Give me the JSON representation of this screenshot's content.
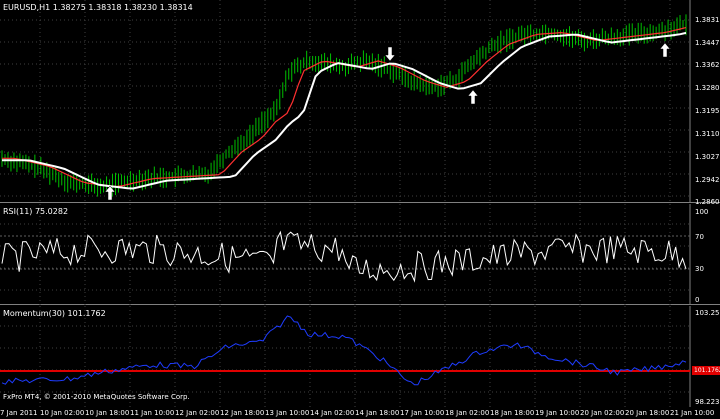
{
  "price_pane": {
    "header": "EURUSD,H1  1.38275 1.38318 1.38230 1.38314",
    "y_ticks": [
      "1.38318",
      "1.34475",
      "1.33625",
      "1.32800",
      "1.31950",
      "1.31100",
      "1.30275",
      "1.29425",
      "1.28600"
    ]
  },
  "rsi_pane": {
    "header": "RSI(11) 75.0282",
    "y_ticks": [
      "100",
      "70",
      "30",
      "0"
    ]
  },
  "momentum_pane": {
    "header": "Momentum(30) 101.1762",
    "y_ticks": [
      "103.252",
      "101.1762",
      "98.2235"
    ],
    "copyright": "FxPro MT4, © 2001-2010 MetaQuotes Software Corp."
  },
  "x_axis": {
    "ticks": [
      "7 Jan 2011",
      "10 Jan 02:00",
      "10 Jan 18:00",
      "11 Jan 10:00",
      "12 Jan 02:00",
      "12 Jan 18:00",
      "13 Jan 10:00",
      "14 Jan 02:00",
      "14 Jan 18:00",
      "17 Jan 10:00",
      "18 Jan 02:00",
      "18 Jan 18:00",
      "19 Jan 10:00",
      "20 Jan 02:00",
      "20 Jan 18:00",
      "21 Jan 10:00"
    ]
  },
  "chart_data": {
    "type": "line",
    "series": [],
    "arrow_signals": [
      "up",
      "down",
      "up",
      "up"
    ]
  },
  "colors": {
    "background": "#000000",
    "candles": "#00c000",
    "ma_fast": "#ff3030",
    "ma_slow": "#ffffff",
    "rsi_line": "#ffffff",
    "momentum_line": "#1e3cff",
    "momentum_level": "#e00000",
    "grid": "#404040"
  }
}
